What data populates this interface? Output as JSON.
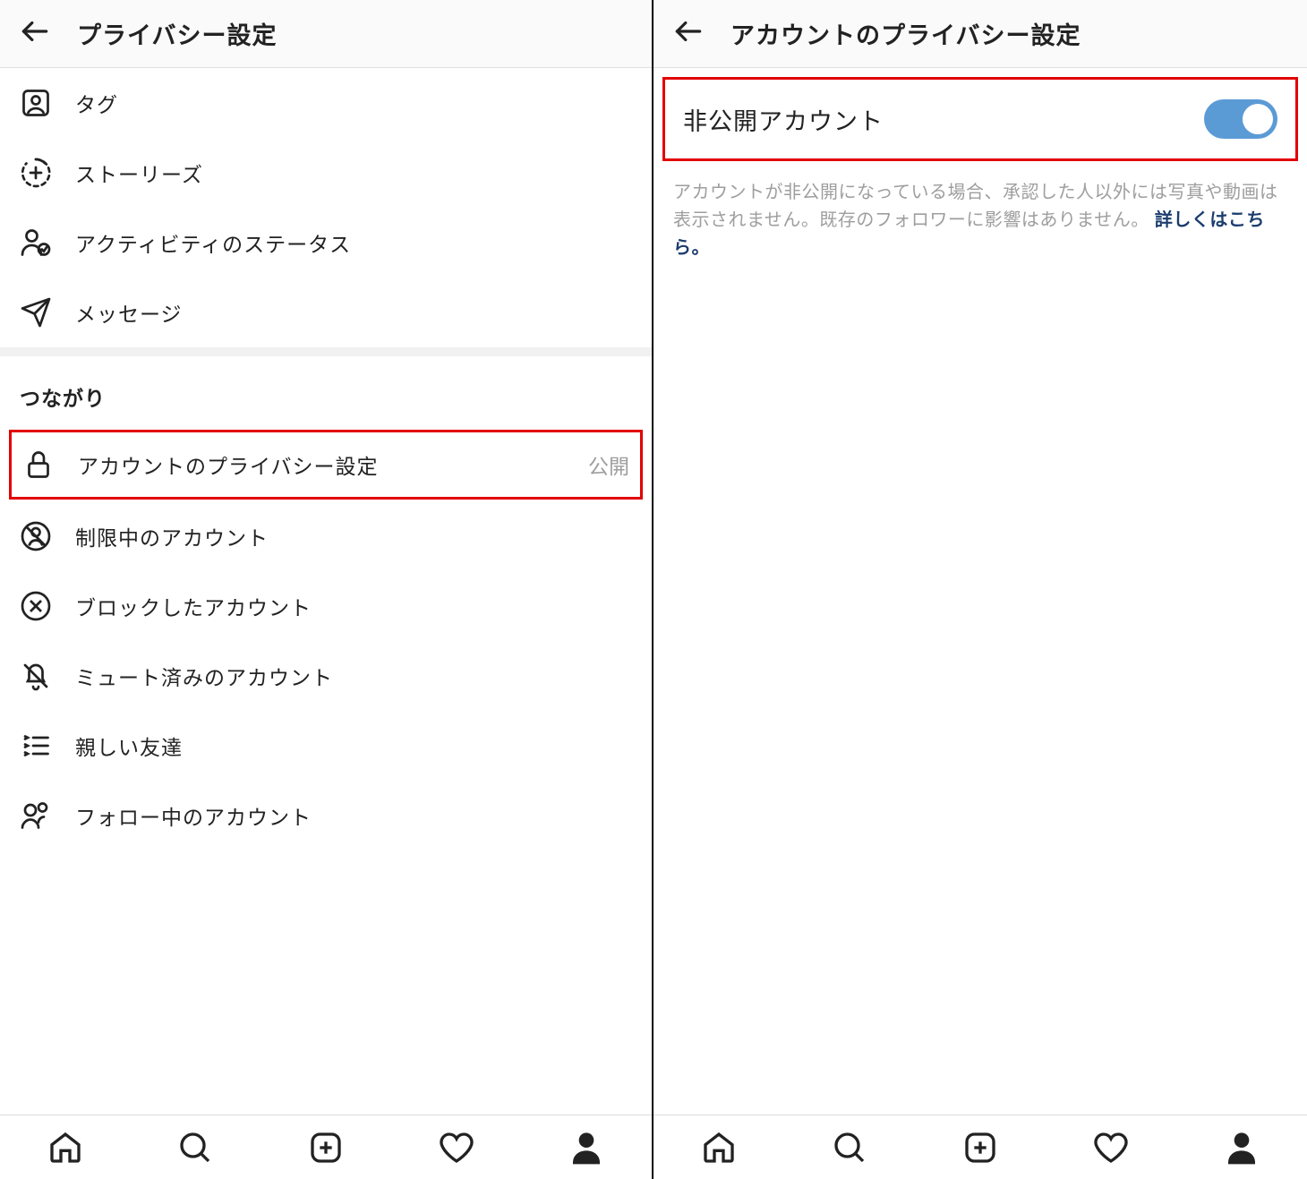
{
  "left": {
    "title": "プライバシー設定",
    "items_top": [
      {
        "label": "タグ",
        "icon": "tag-person-icon"
      },
      {
        "label": "ストーリーズ",
        "icon": "stories-add-icon"
      },
      {
        "label": "アクティビティのステータス",
        "icon": "activity-status-icon"
      },
      {
        "label": "メッセージ",
        "icon": "message-send-icon"
      }
    ],
    "section_title": "つながり",
    "items_bottom": [
      {
        "label": "アカウントのプライバシー設定",
        "value": "公開",
        "icon": "lock-icon",
        "highlighted": true
      },
      {
        "label": "制限中のアカウント",
        "icon": "restricted-account-icon"
      },
      {
        "label": "ブロックしたアカウント",
        "icon": "blocked-x-icon"
      },
      {
        "label": "ミュート済みのアカウント",
        "icon": "muted-bell-icon"
      },
      {
        "label": "親しい友達",
        "icon": "close-friends-icon"
      },
      {
        "label": "フォロー中のアカウント",
        "icon": "following-accounts-icon"
      }
    ]
  },
  "right": {
    "title": "アカウントのプライバシー設定",
    "private_account_label": "非公開アカウント",
    "private_account_on": true,
    "description_text": "アカウントが非公開になっている場合、承認した人以外には写真や動画は表示されません。既存のフォロワーに影響はありません。",
    "description_link": "詳しくはこちら。"
  }
}
